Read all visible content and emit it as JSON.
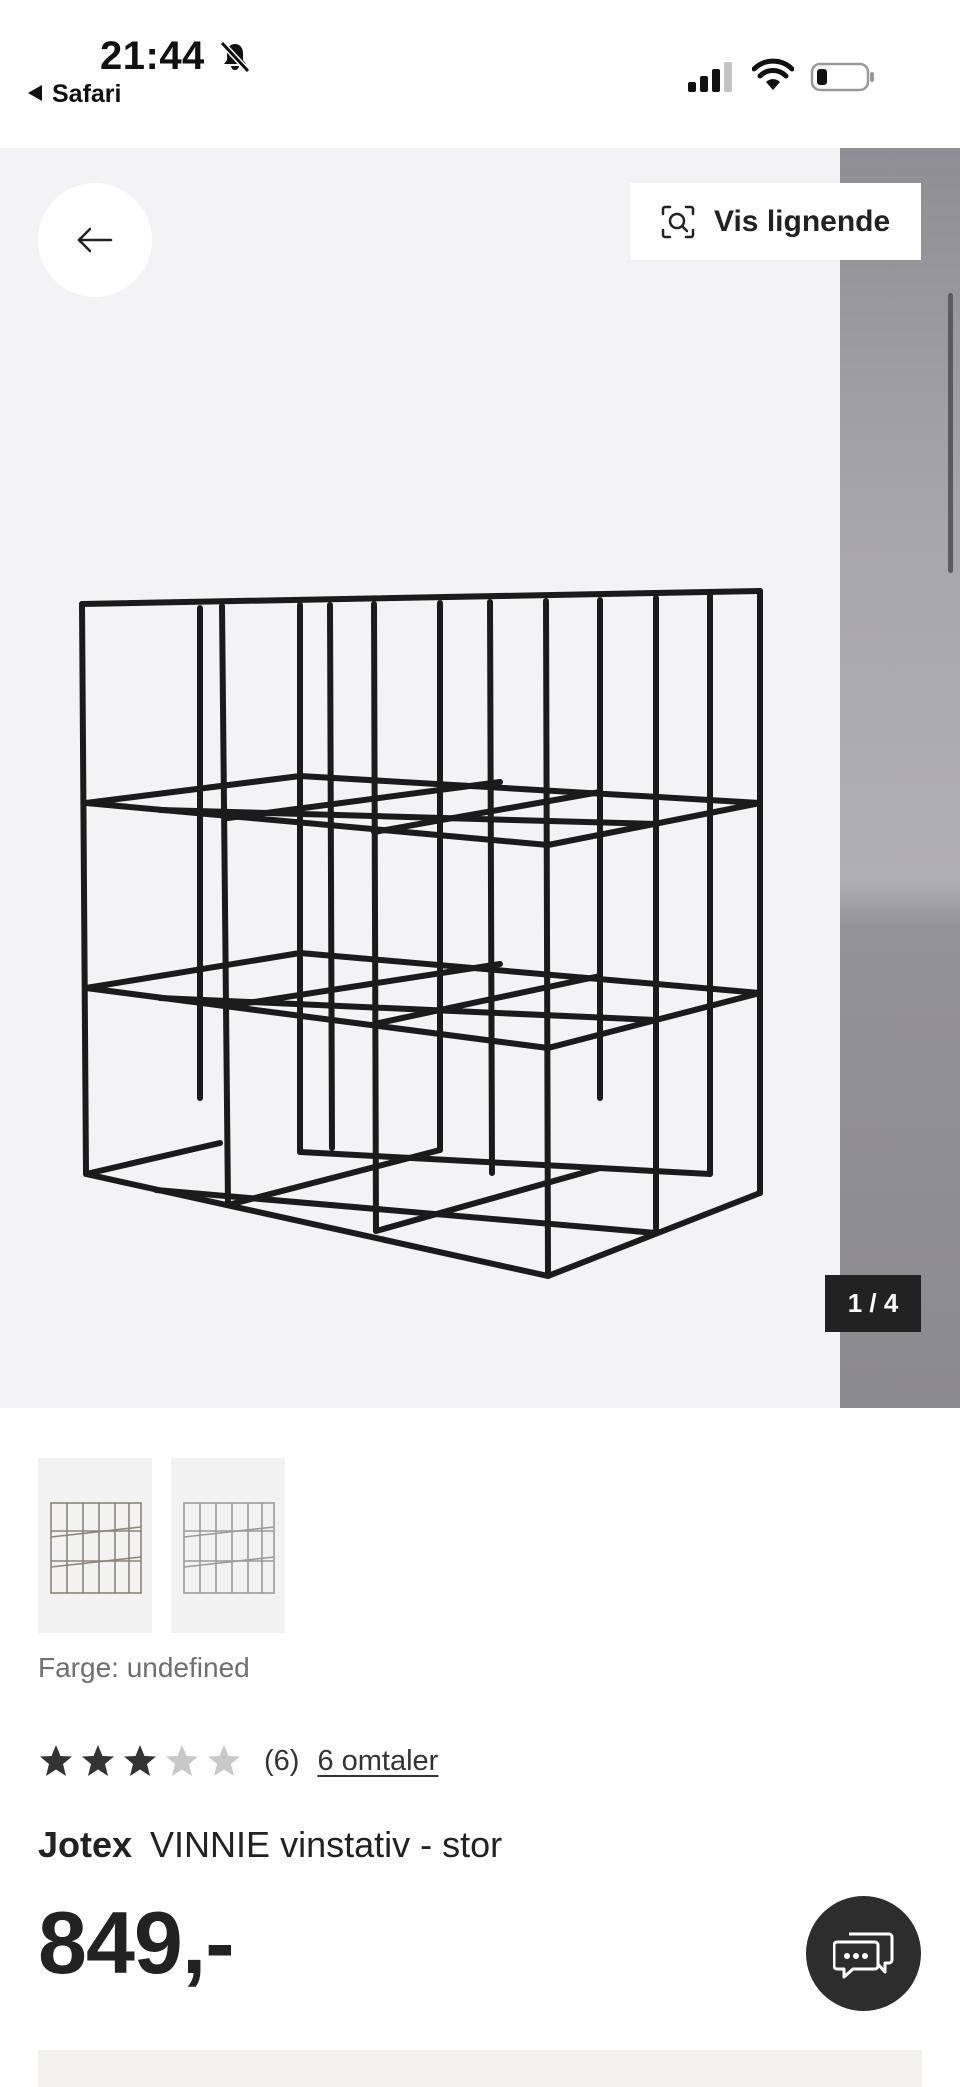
{
  "status_bar": {
    "time": "21:44",
    "back_app": "Safari",
    "icons": [
      "bell-slash-icon",
      "cellular-signal-icon",
      "wifi-icon",
      "battery-icon"
    ]
  },
  "gallery": {
    "similar_button_label": "Vis lignende",
    "counter": "1 / 4",
    "current_image": 1,
    "total_images": 4
  },
  "thumbnails": [
    {
      "name": "thumbnail-1"
    },
    {
      "name": "thumbnail-2"
    }
  ],
  "product": {
    "color_label": "Farge: undefined",
    "rating": 3,
    "rating_max": 5,
    "rating_count": "(6)",
    "reviews_link": "6 omtaler",
    "brand": "Jotex",
    "name": "VINNIE vinstativ - stor",
    "price": "849,-"
  },
  "colors": {
    "star_filled": "#333333",
    "star_empty": "#c8c8c8",
    "counter_bg": "#222222",
    "chat_bg": "#2d2d2d",
    "gallery_bg": "#f3f3f5"
  }
}
